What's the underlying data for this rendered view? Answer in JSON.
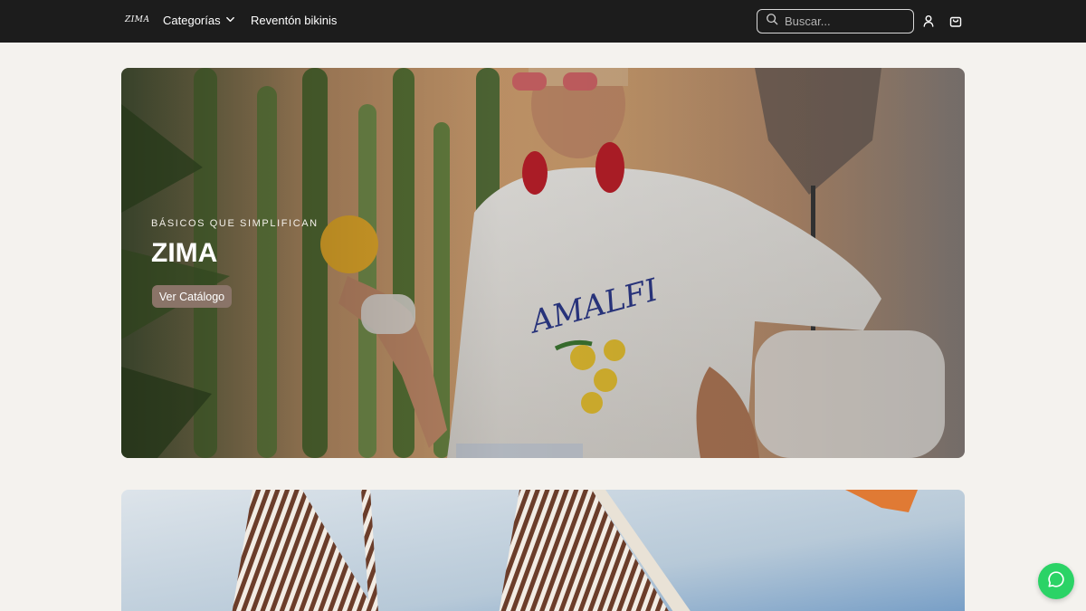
{
  "header": {
    "logo_text": "ZIMA",
    "nav_categories_label": "Categorías",
    "nav_link_label": "Reventón bikinis",
    "search_placeholder": "Buscar..."
  },
  "hero": {
    "eyebrow": "BÁSICOS QUE SIMPLIFICAN",
    "title": "ZIMA",
    "button_label": "Ver Catálogo"
  },
  "icons": {
    "search": "search-icon",
    "account": "user-icon",
    "cart": "shopping-bag-icon",
    "dropdown": "chevron-down-icon",
    "whatsapp": "whatsapp-icon"
  },
  "colors": {
    "header_bg": "#1c1c1c",
    "page_bg": "#f4f2ee",
    "hero_button": "#8a7468",
    "whatsapp": "#2bd366"
  }
}
